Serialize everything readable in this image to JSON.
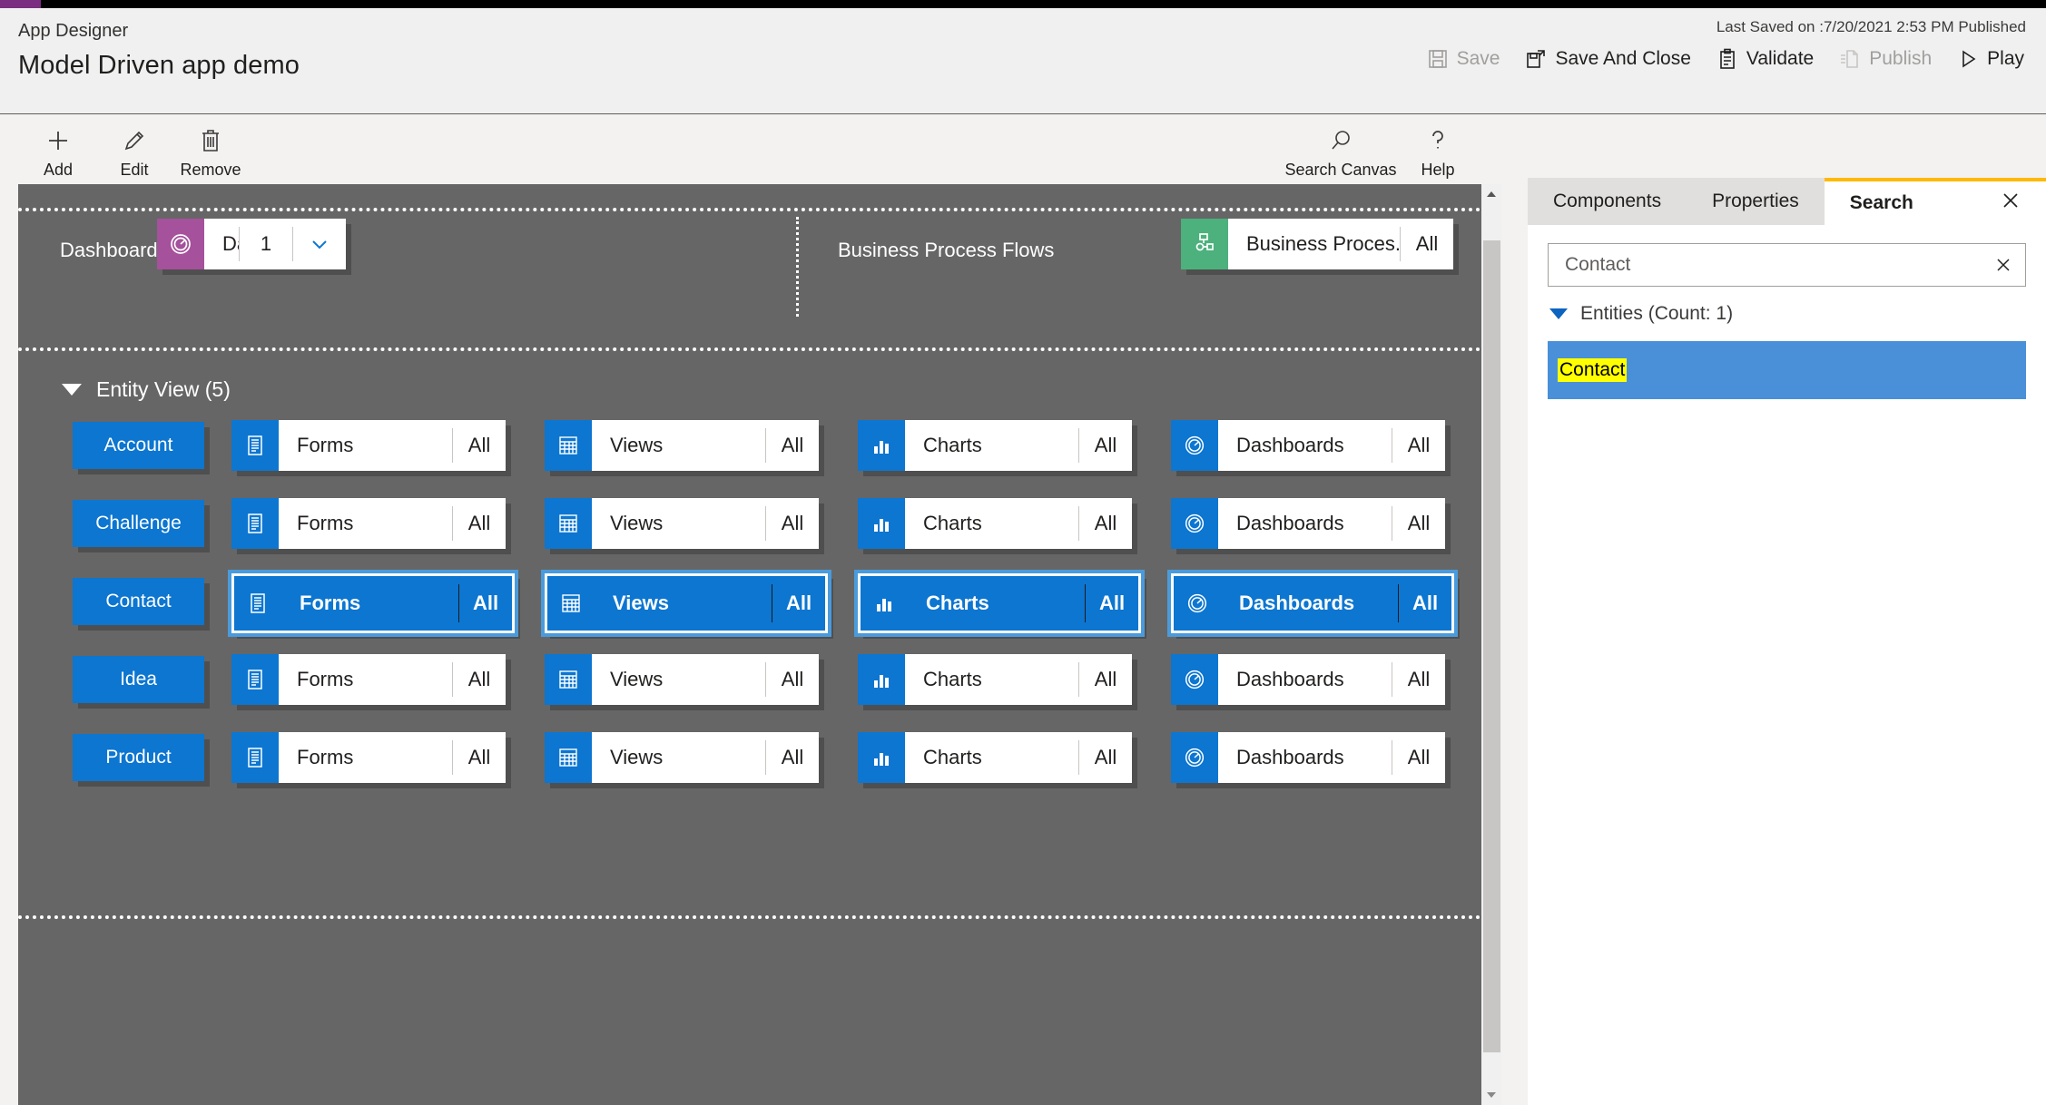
{
  "header": {
    "app_label": "App Designer",
    "app_title": "Model Driven app demo",
    "last_saved": "Last Saved on :7/20/2021 2:53 PM Published",
    "commands": [
      {
        "label": "Save",
        "icon": "save-icon",
        "disabled": true
      },
      {
        "label": "Save And Close",
        "icon": "save-and-close-icon",
        "disabled": false
      },
      {
        "label": "Validate",
        "icon": "validate-clipboard-icon",
        "disabled": false
      },
      {
        "label": "Publish",
        "icon": "publish-page-icon",
        "disabled": true
      },
      {
        "label": "Play",
        "icon": "play-triangle-icon",
        "disabled": false
      }
    ]
  },
  "toolbar": {
    "left": [
      {
        "label": "Add",
        "icon": "plus-icon"
      },
      {
        "label": "Edit",
        "icon": "pencil-icon"
      },
      {
        "label": "Remove",
        "icon": "trash-icon"
      }
    ],
    "right": [
      {
        "label": "Search Canvas",
        "icon": "magnifier-icon"
      },
      {
        "label": "Help",
        "icon": "question-mark-icon"
      }
    ]
  },
  "canvas": {
    "dashboards_row": {
      "label": "Dashboards",
      "tile": {
        "name": "Dashboards",
        "count": "1",
        "icon": "dashboard-gauge-icon",
        "color": "#a5519c",
        "chevron": "chevron-down-icon"
      }
    },
    "bpf_row": {
      "label": "Business Process Flows",
      "tile": {
        "name": "Business Proces...",
        "count": "All",
        "icon": "process-flow-icon",
        "color": "#4cb17c"
      }
    },
    "entity_view": {
      "header": "Entity View (5)",
      "column_tiles": [
        {
          "name": "Forms",
          "count": "All",
          "icon": "forms-icon"
        },
        {
          "name": "Views",
          "count": "All",
          "icon": "views-grid-icon"
        },
        {
          "name": "Charts",
          "count": "All",
          "icon": "charts-bar-icon"
        },
        {
          "name": "Dashboards",
          "count": "All",
          "icon": "dashboard-gauge-icon"
        }
      ],
      "rows": [
        {
          "entity": "Account",
          "selected": false
        },
        {
          "entity": "Challenge",
          "selected": false
        },
        {
          "entity": "Contact",
          "selected": true
        },
        {
          "entity": "Idea",
          "selected": false
        },
        {
          "entity": "Product",
          "selected": false
        }
      ]
    }
  },
  "panel": {
    "tabs": [
      {
        "label": "Components",
        "active": false
      },
      {
        "label": "Properties",
        "active": false
      },
      {
        "label": "Search",
        "active": true
      }
    ],
    "close_icon": "close-icon",
    "search": {
      "value": "Contact",
      "clear_icon": "clear-x-icon"
    },
    "results": {
      "group_label": "Entities (Count: 1)",
      "items": [
        {
          "label": "Contact",
          "highlighted": true
        }
      ]
    }
  },
  "colors": {
    "accent_purple": "#7b2d82",
    "tile_blue": "#0c76d1",
    "selection_blue": "#4a9bdc",
    "canvas_gray": "#666666",
    "tab_accent": "#ffb900",
    "result_blue": "#4a90d9",
    "highlight_yellow": "#ffff00"
  }
}
